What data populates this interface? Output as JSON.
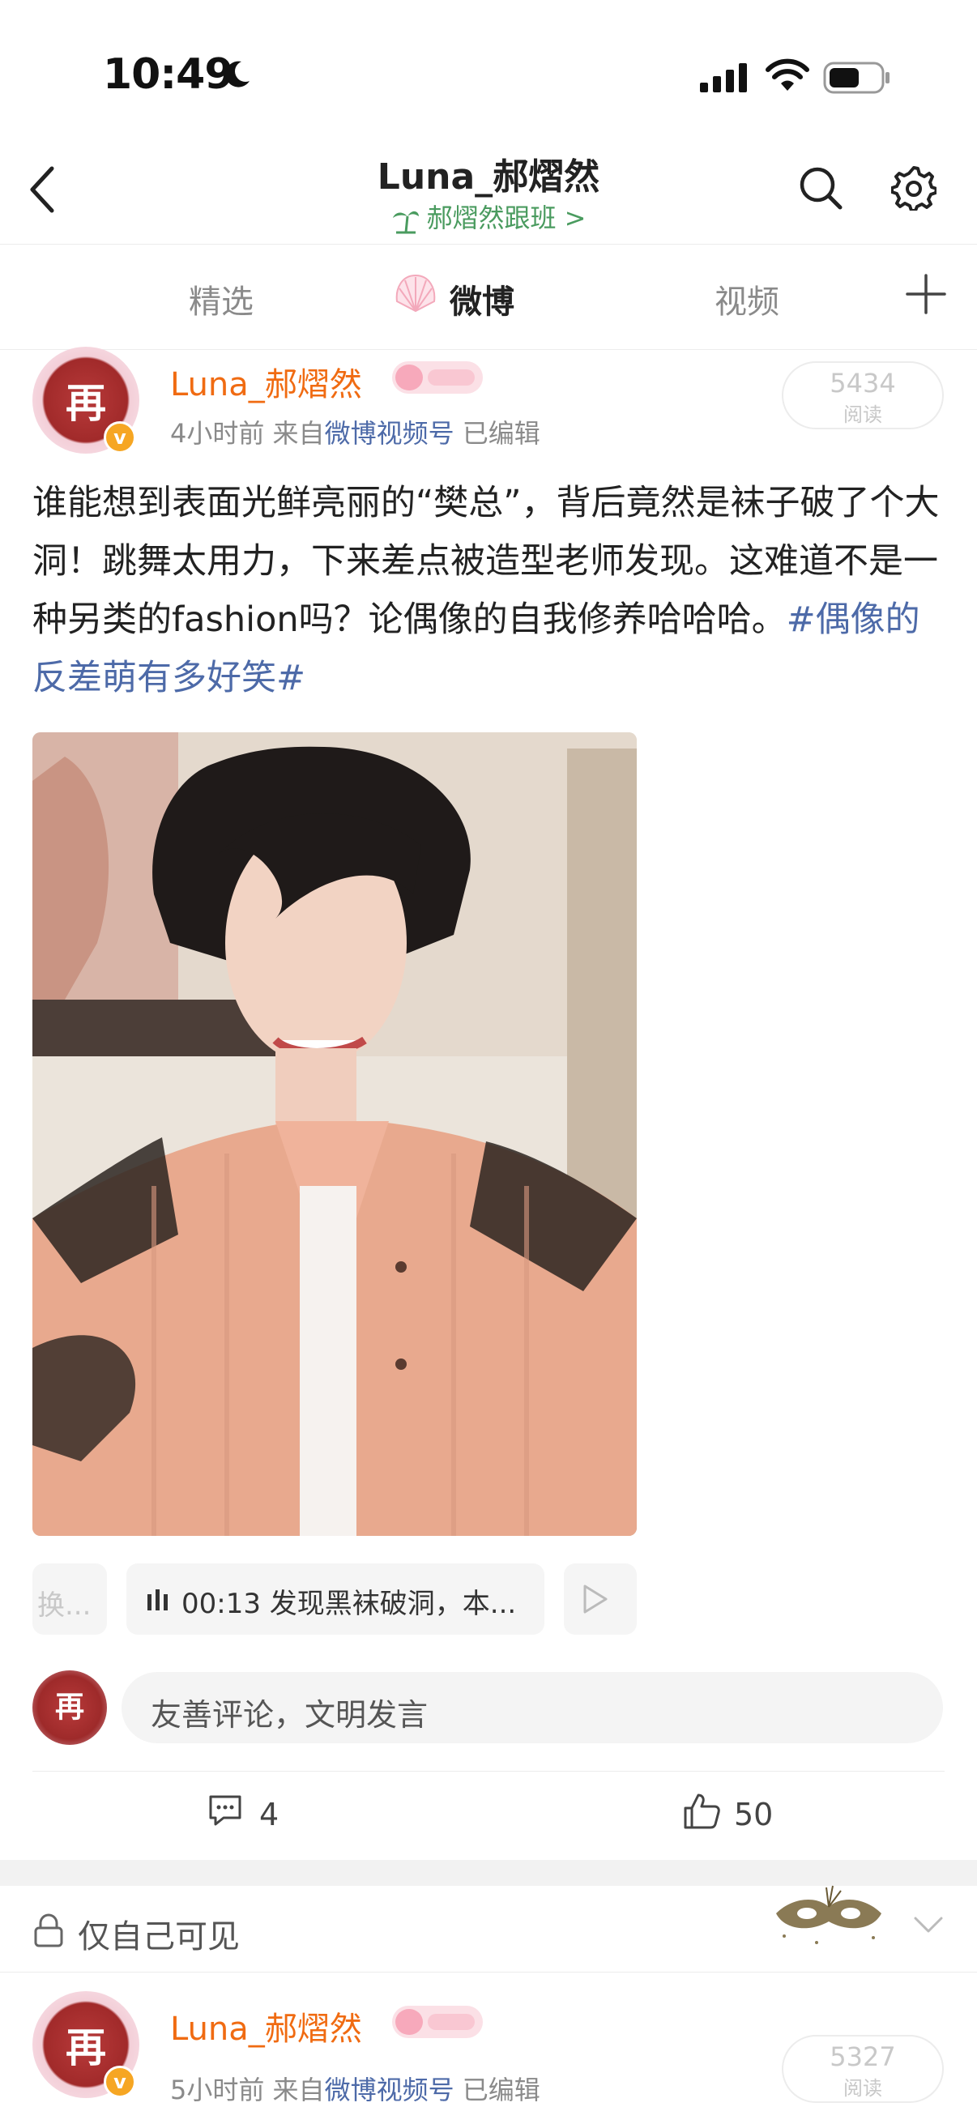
{
  "status_bar": {
    "time": "10:49"
  },
  "header": {
    "title": "Luna_郝熠然",
    "subtitle": "郝熠然跟班 >"
  },
  "tabs": [
    {
      "label": "精选"
    },
    {
      "label": "微博"
    },
    {
      "label": "视频"
    }
  ],
  "post1": {
    "author": "Luna_郝熠然",
    "avatar_text": "再",
    "time": "4小时前",
    "from_prefix": "来自",
    "source": "微博视频号",
    "edited": "已编辑",
    "reads": "5434",
    "reads_label": "阅读",
    "text": "谁能想到表面光鲜亮丽的“樊总”，背后竟然是袜子破了个大洞！跳舞太用力，下来差点被造型老师发现。这难道不是一种另类的fashion吗？论偶像的自我修养哈哈哈。",
    "hashtag": "#偶像的反差萌有多好笑#",
    "chips": [
      {
        "label": "换..."
      },
      {
        "label": "00:13 发现黑袜破洞，本..."
      },
      {
        "label": ""
      }
    ],
    "comment_placeholder": "友善评论，文明发言",
    "comments": "4",
    "likes": "50"
  },
  "visibility": {
    "label": "仅自己可见"
  },
  "post2": {
    "author": "Luna_郝熠然",
    "avatar_text": "再",
    "time": "5小时前",
    "from_prefix": "来自",
    "source": "微博视频号",
    "edited": "已编辑",
    "reads": "5327",
    "reads_label": "阅读"
  },
  "colors": {
    "accent_orange": "#f06b12",
    "link_blue": "#4d6aa8",
    "subtitle_green": "#4a9b5f",
    "verified_badge": "#f6a623"
  },
  "icons": [
    "back-icon",
    "search-icon",
    "gear-icon",
    "plus-icon",
    "comment-icon",
    "like-icon",
    "lock-icon",
    "chevron-down-icon",
    "play-icon",
    "audio-bars-icon"
  ]
}
